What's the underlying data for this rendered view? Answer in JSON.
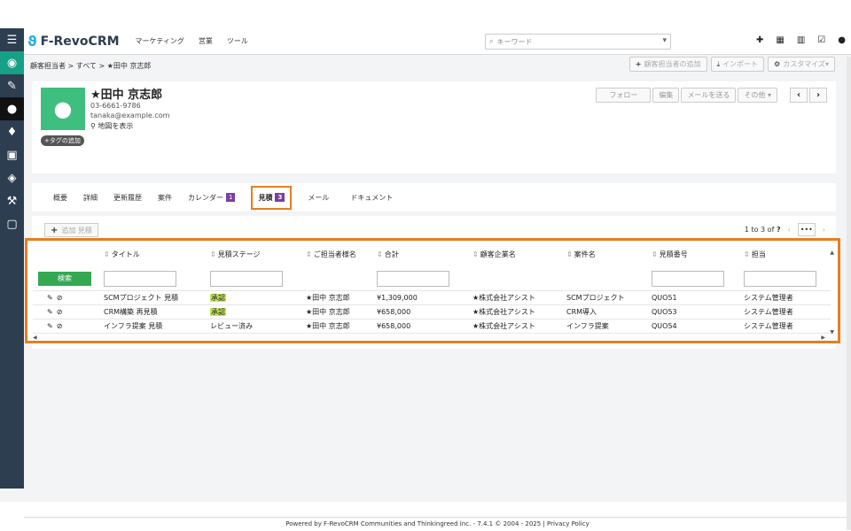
{
  "app": {
    "name": "F-RevoCRM",
    "topnav": [
      "マーケティング",
      "営業",
      "ツール"
    ]
  },
  "search": {
    "placeholder": "キーワード"
  },
  "breadcrumb": {
    "a": "顧客担当者",
    "b": "すべて",
    "c": "★田中 京志郎"
  },
  "header_buttons": {
    "add": "顧客担当者の追加",
    "import": "インポート",
    "customize": "カスタマイズ"
  },
  "contact": {
    "name": "★田中 京志郎",
    "phone": "03-6661-9786",
    "email": "tanaka@example.com",
    "map": "地図を表示",
    "tag": "タグの追加"
  },
  "card_buttons": {
    "follow": "フォロー",
    "edit": "編集",
    "mail": "メールを送る",
    "more": "その他"
  },
  "tabs": [
    {
      "label": "概要"
    },
    {
      "label": "詳細"
    },
    {
      "label": "更新履歴"
    },
    {
      "label": "案件"
    },
    {
      "label": "カレンダー",
      "badge": "1"
    },
    {
      "label": "見積",
      "badge": "3"
    },
    {
      "label": "メール"
    },
    {
      "label": "ドキュメント"
    }
  ],
  "toolbar": {
    "add_label": "追加 見積"
  },
  "pager": {
    "text": "1 to 3  of",
    "q": "?"
  },
  "grid": {
    "headers": [
      "タイトル",
      "見積ステージ",
      "ご担当者様名",
      "合計",
      "顧客企業名",
      "案件名",
      "見積番号",
      "担当"
    ],
    "search_label": "検索",
    "rows": [
      [
        "SCMプロジェクト 見積",
        "承認",
        "★田中 京志郎",
        "¥1,309,000",
        "★株式会社アシスト",
        "SCMプロジェクト",
        "QUO51",
        "システム管理者"
      ],
      [
        "CRM構築 再見積",
        "承認",
        "★田中 京志郎",
        "¥658,000",
        "★株式会社アシスト",
        "CRM導入",
        "QUO53",
        "システム管理者"
      ],
      [
        "インフラ提案 見積",
        "レビュー済み",
        "★田中 京志郎",
        "¥658,000",
        "★株式会社アシスト",
        "インフラ提案",
        "QUO54",
        "システム管理者"
      ]
    ]
  },
  "footer": "Powered by F-RevoCRM Communities and Thinkingreed Inc. - 7.4.1  © 2004 - 2025    |  Privacy Policy",
  "colors": {
    "accent": "#e67e22",
    "badge": "#7b3fa5",
    "highlight": "#c5e85a",
    "rail": "#2c3e50"
  }
}
